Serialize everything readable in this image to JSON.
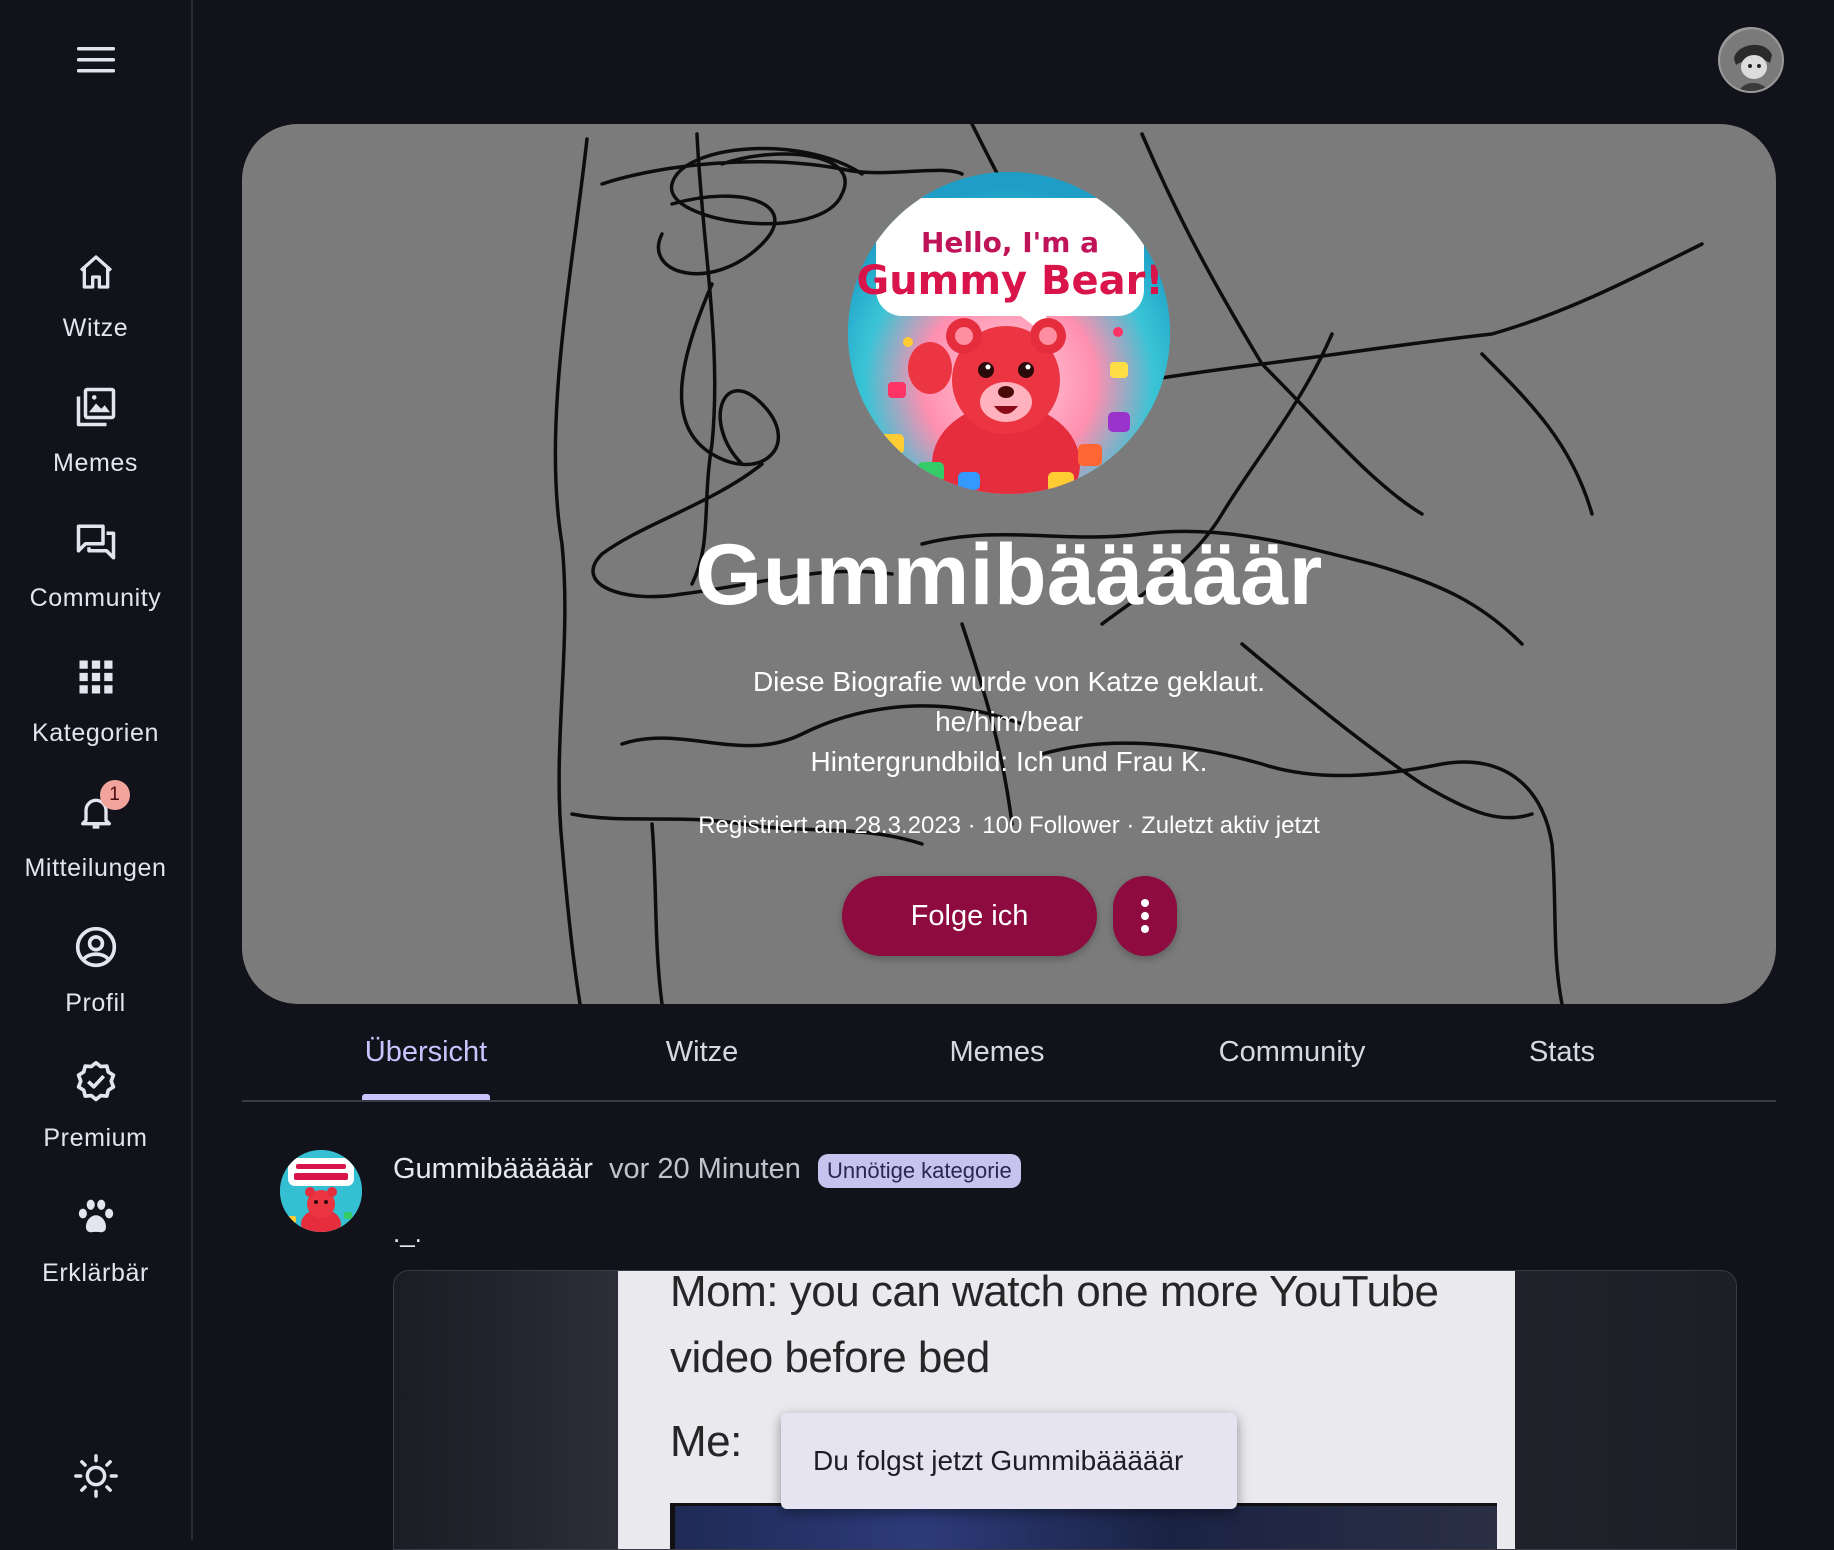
{
  "sidebar": {
    "menu_icon": "hamburger-menu-icon",
    "items": [
      {
        "label": "Witze",
        "icon": "home-icon"
      },
      {
        "label": "Memes",
        "icon": "image-gallery-icon"
      },
      {
        "label": "Community",
        "icon": "chat-bubbles-icon"
      },
      {
        "label": "Kategorien",
        "icon": "grid-icon"
      },
      {
        "label": "Mitteilungen",
        "icon": "bell-icon",
        "badge": "1"
      },
      {
        "label": "Profil",
        "icon": "user-circle-icon"
      },
      {
        "label": "Premium",
        "icon": "verified-badge-icon"
      },
      {
        "label": "Erklärbär",
        "icon": "paw-icon"
      }
    ],
    "theme_icon": "sun-icon"
  },
  "topbar": {
    "avatar_icon": "user-avatar"
  },
  "profile": {
    "picture_caption_line1": "Hello, I'm a",
    "picture_caption_line2": "Gummy Bear!",
    "name": "Gummibääääär",
    "bio_lines": [
      "Diese Biografie wurde von Katze geklaut.",
      "he/him/bear",
      "Hintergrundbild: Ich und Frau K."
    ],
    "meta": "Registriert am 28.3.2023 · 100 Follower · Zuletzt aktiv jetzt",
    "follow_label": "Folge ich",
    "more_icon": "more-vertical-icon"
  },
  "tabs": [
    {
      "label": "Übersicht",
      "active": true
    },
    {
      "label": "Witze",
      "active": false
    },
    {
      "label": "Memes",
      "active": false
    },
    {
      "label": "Community",
      "active": false
    },
    {
      "label": "Stats",
      "active": false
    }
  ],
  "post": {
    "author": "Gummibääääär",
    "time": "vor 20 Minuten",
    "category": "Unnötige kategorie",
    "text": "._.",
    "meme_lines": [
      "Mom: you can watch one more YouTube",
      "video before bed",
      "Me:"
    ]
  },
  "toast": {
    "message": "Du folgst jetzt Gummibääääär"
  },
  "colors": {
    "accent": "#8d0b3e",
    "tab_active": "#c9c4ff",
    "background": "#12131a",
    "badge": "#f2a39b"
  }
}
